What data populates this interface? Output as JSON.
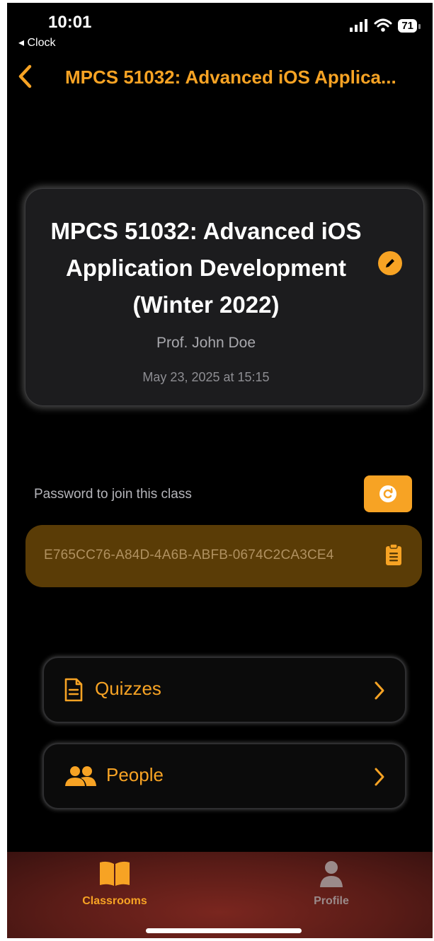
{
  "status_bar": {
    "time": "10:01",
    "back_app": "◂ Clock",
    "battery": "71"
  },
  "nav": {
    "title": "MPCS 51032: Advanced iOS Applica..."
  },
  "class_card": {
    "title_line1": "MPCS 51032: Advanced iOS",
    "title_line2": "Application Development",
    "title_line3": "(Winter 2022)",
    "professor": "Prof. John Doe",
    "date": "May 23, 2025 at 15:15"
  },
  "password": {
    "label": "Password to join this class",
    "value": "E765CC76-A84D-4A6B-ABFB-0674C2CA3CE4"
  },
  "menu": {
    "quizzes_label": "Quizzes",
    "people_label": "People"
  },
  "tabbar": {
    "classrooms_label": "Classrooms",
    "profile_label": "Profile"
  },
  "colors": {
    "accent": "#F7A324",
    "background": "#000000",
    "card": "#1C1C1E",
    "password_field": "#5A3C06",
    "tab_inactive": "#9A8A8A"
  },
  "icons": {
    "back": "chevron-left-icon",
    "edit": "pencil-icon",
    "refresh": "refresh-icon",
    "copy": "clipboard-icon",
    "quizzes": "document-icon",
    "people": "people-icon",
    "classrooms": "book-icon",
    "profile": "person-icon"
  }
}
